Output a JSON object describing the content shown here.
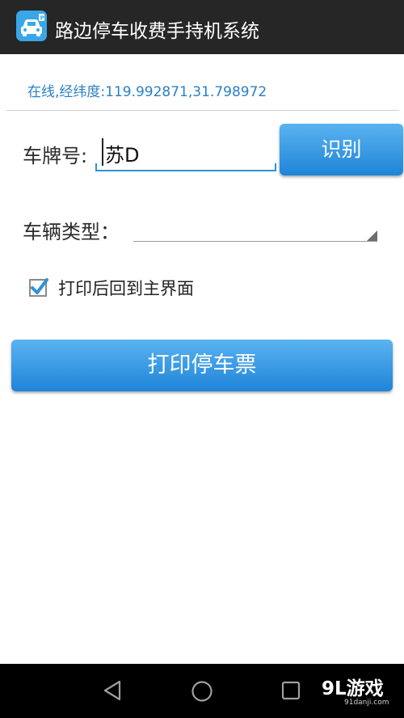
{
  "app": {
    "title": "路边停车收费手持机系统",
    "icon": "parking-car-icon",
    "accent": "#2e93d6"
  },
  "status": {
    "text": "在线,经纬度:119.992871,31.798972"
  },
  "form": {
    "plate_label": "车牌号:",
    "plate_value": "苏D",
    "recognize_label": "识别",
    "vehicle_type_label": "车辆类型：",
    "vehicle_type_value": "",
    "return_checkbox_label": "打印后回到主界面",
    "return_checkbox_checked": true,
    "print_button_label": "打印停车票"
  },
  "navbar": {
    "back_icon": "back-triangle-icon",
    "home_icon": "home-circle-icon",
    "recents_icon": "recents-square-icon"
  },
  "watermark": {
    "logo": "9L游戏",
    "sub": "91danji.com"
  }
}
